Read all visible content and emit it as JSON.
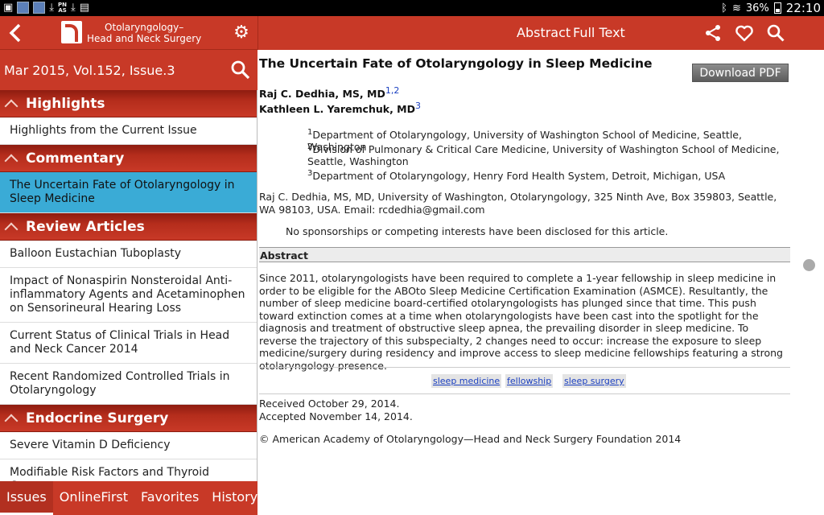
{
  "status_bar": {
    "battery": "36%",
    "time": "22:10",
    "left_icons": [
      "jop-icon",
      "jop-icon",
      "download-icon",
      "pnas-icon",
      "download-icon",
      "clipboard-icon"
    ],
    "pnas_line1": "PN",
    "pnas_line2": "AS"
  },
  "left_header": {
    "journal_line1": "Otolaryngology–",
    "journal_line2": "Head and Neck Surgery"
  },
  "issue": {
    "label": "Mar 2015, Vol.152, Issue.3"
  },
  "toc": {
    "sections": [
      {
        "title": "Highlights",
        "items": [
          "Highlights from the Current Issue"
        ]
      },
      {
        "title": "Commentary",
        "items": [
          "The Uncertain Fate of Otolaryngology in Sleep Medicine"
        ]
      },
      {
        "title": "Review Articles",
        "items": [
          "Balloon Eustachian Tuboplasty",
          "Impact of Nonaspirin Nonsteroidal Anti-inflammatory Agents and Acetaminophen on Sensorineural Hearing Loss",
          "Current Status of Clinical Trials in Head and Neck Cancer 2014",
          "Recent Randomized Controlled Trials in Otolaryngology"
        ]
      },
      {
        "title": "Endocrine Surgery",
        "items": [
          "Severe Vitamin D Deficiency",
          "Modifiable Risk Factors and Thyroid Cancer"
        ]
      }
    ]
  },
  "bottom_tabs": [
    "Issues",
    "OnlineFirst",
    "Favorites",
    "History"
  ],
  "right_header": {
    "tab_abstract": "Abstract",
    "tab_fulltext": "Full Text"
  },
  "article": {
    "title": "The Uncertain Fate of Otolaryngology in Sleep Medicine",
    "download_label": "Download PDF",
    "author1": "Raj C. Dedhia, MS, MD",
    "author1_sup": "1,2",
    "author2": "Kathleen L. Yaremchuk, MD",
    "author2_sup": "3",
    "affil1_sup": "1",
    "affil1": "Department of Otolaryngology, University of Washington School of Medicine, Seattle, Washington",
    "affil2_sup": "2",
    "affil2": "Division of Pulmonary & Critical Care Medicine, University of Washington School of Medicine, Seattle, Washington",
    "affil3_sup": "3",
    "affil3": "Department of Otolaryngology, Henry Ford Health System, Detroit, Michigan, USA",
    "contact": "Raj C. Dedhia, MS, MD, University of Washington, Otolaryngology, 325 Ninth Ave, Box 359803, Seattle, WA 98103, USA. Email: rcdedhia@gmail.com",
    "disclosure": "No sponsorships or competing interests have been disclosed for this article.",
    "abstract_heading": "Abstract",
    "abstract_text": "Since 2011, otolaryngologists have been required to complete a 1-year fellowship in sleep medicine in order to be eligible for the ABOto Sleep Medicine Certification Examination (ASMCE). Resultantly, the number of sleep medicine board-certified otolaryngologists has plunged since that time. This push toward extinction comes at a time when otolaryngologists have been cast into the spotlight for the diagnosis and treatment of obstructive sleep apnea, the prevailing disorder in sleep medicine. To reverse the trajectory of this subspecialty, 2 changes need to occur: increase the exposure to sleep medicine/surgery during residency and improve access to sleep medicine fellowships featuring a strong otolaryngology presence.",
    "keywords": [
      "sleep medicine",
      "fellowship",
      "sleep surgery"
    ],
    "received": "Received October 29, 2014.",
    "accepted": "Accepted November 14, 2014.",
    "copyright": "© American Academy of Otolaryngology—Head and Neck Surgery Foundation 2014"
  },
  "colors": {
    "header_red": "#c83927",
    "selected_blue": "#3aabd6"
  }
}
